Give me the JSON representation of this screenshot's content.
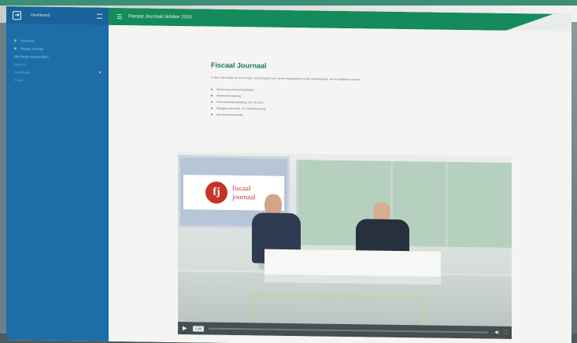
{
  "app": {
    "sidebar_title": "Dashboard",
    "logo_glyph": "⇥"
  },
  "sidebar": {
    "items": [
      {
        "label": "Overzicht",
        "dot": true
      },
      {
        "label": "Fiscaal Journaal",
        "dot": true
      },
      {
        "label": "Alle fiscale onderwerpen",
        "dot": false
      },
      {
        "label": "Agenda",
        "dot": false
      },
      {
        "label": "Instellingen",
        "dot": false,
        "caret": true
      },
      {
        "label": "Profiel",
        "dot": false
      }
    ]
  },
  "topbar": {
    "title": "Fiscaal Journaal oktober 2016",
    "menu_icon": "menu-icon",
    "close_icon": "close-icon"
  },
  "article": {
    "title": "Fiscaal Journaal",
    "intro": "In deze aflevering van het Fiscaal Journaal gaan wij in op de belangrijkste fiscale ontwikkelingen van de afgelopen periode.",
    "bullets": [
      "Herziening pensioenregelingen",
      "Werkkostenregeling",
      "Vennootschapsbelasting over de winst",
      "Wijziging successie- en schenkbelasting",
      "Nieuwe jurisprudentie"
    ]
  },
  "video": {
    "brand_initials": "fj",
    "brand_line1": "fiscaal",
    "brand_line2": "journaal",
    "time": "0:00",
    "progress": 0.0,
    "play_icon": "play-icon",
    "volume_icon": "volume-icon",
    "fullscreen_icon": "fullscreen-icon"
  },
  "colors": {
    "sidebar": "#1d6ea8",
    "topbar": "#158a5c",
    "accent_title": "#17784f",
    "brand_red": "#c4342b"
  }
}
